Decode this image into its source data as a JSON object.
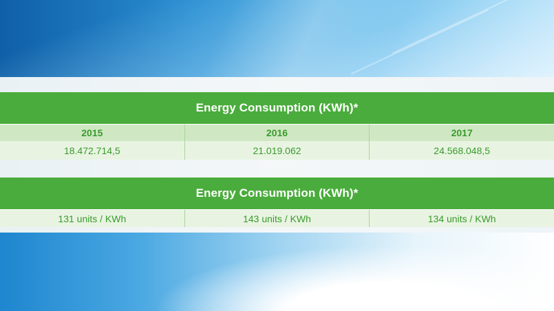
{
  "table1": {
    "title": "Energy Consumption (KWh)*",
    "years": [
      "2015",
      "2016",
      "2017"
    ],
    "values": [
      "18.472.714,5",
      "21.019.062",
      "24.568.048,5"
    ]
  },
  "table2": {
    "title": "Energy Consumption (KWh)*",
    "values": [
      "131 units / KWh",
      "143 units / KWh",
      "134 units / KWh"
    ]
  },
  "colors": {
    "header_green": "#4aac3c",
    "light_green": "#cfe8c3",
    "pale_green": "#e8f4e1",
    "text_green": "#3a9a2d"
  }
}
